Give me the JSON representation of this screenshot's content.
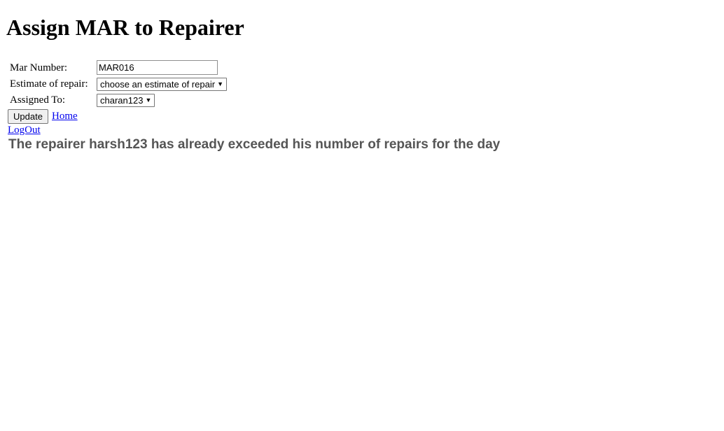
{
  "page": {
    "title": "Assign MAR to Repairer"
  },
  "form": {
    "mar_number_label": "Mar Number:",
    "mar_number_value": "MAR016",
    "estimate_label": "Estimate of repair:",
    "estimate_selected": "choose an estimate of repair",
    "assigned_label": "Assigned To:",
    "assigned_selected": "charan123",
    "update_label": "Update"
  },
  "links": {
    "home": "Home",
    "logout": "LogOut"
  },
  "status": {
    "message": "The repairer harsh123 has already exceeded his number of repairs for the day",
    "color": "#555555"
  },
  "icons": {
    "dropdown": "chevron-down-icon"
  }
}
